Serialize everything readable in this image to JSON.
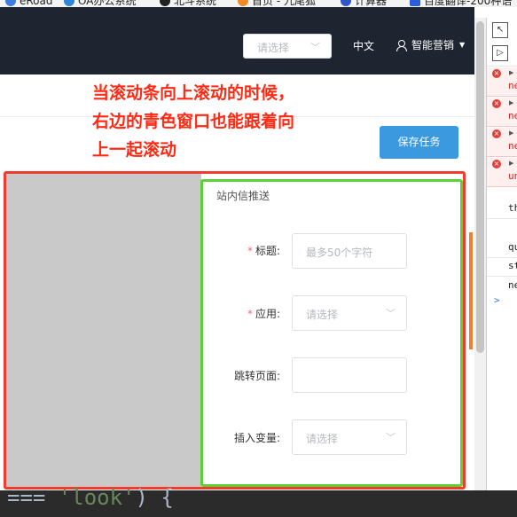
{
  "bookmarks": [
    {
      "label": "eRoad",
      "icon": "eroad-icon"
    },
    {
      "label": "OA办公系统",
      "icon": "oa-icon"
    },
    {
      "label": "北斗系统",
      "icon": "beidou-icon"
    },
    {
      "label": "首页 - 九尾狐",
      "icon": "fox-icon"
    },
    {
      "label": "计算器",
      "icon": "calculator-icon"
    },
    {
      "label": "百度翻译-200种语",
      "icon": "translate-icon"
    }
  ],
  "header": {
    "select_placeholder": "请选择",
    "language": "中文",
    "user": "智能营销"
  },
  "toolbar": {
    "save_label": "保存任务"
  },
  "annotation": {
    "lines": [
      "当滚动条向上滚动的时候，",
      "右边的青色窗口也能跟着向",
      "上一起滚动"
    ],
    "color": "#ff2a14"
  },
  "panel": {
    "title": "站内信推送",
    "fields": [
      {
        "label": "标题:",
        "required": true,
        "placeholder": "最多50个字符",
        "type": "text"
      },
      {
        "label": "应用:",
        "required": true,
        "placeholder": "请选择",
        "type": "select"
      },
      {
        "label": "跳转页面:",
        "required": false,
        "placeholder": "",
        "type": "text"
      },
      {
        "label": "插入变量:",
        "required": false,
        "placeholder": "请选择",
        "type": "select"
      }
    ]
  },
  "devtools": {
    "errors": [
      "ne",
      "ne",
      "ne",
      "un"
    ],
    "logs": [
      "th",
      "qu",
      "st",
      "ne"
    ],
    "prompt": ">"
  },
  "editor": {
    "code_prefix": "=== ",
    "code_string": "'look'",
    "code_suffix": ") {"
  },
  "colors": {
    "header_bg": "#1e2530",
    "primary_button": "#3b99e0",
    "frame_red": "#f03c2e",
    "frame_green": "#5cd137"
  }
}
